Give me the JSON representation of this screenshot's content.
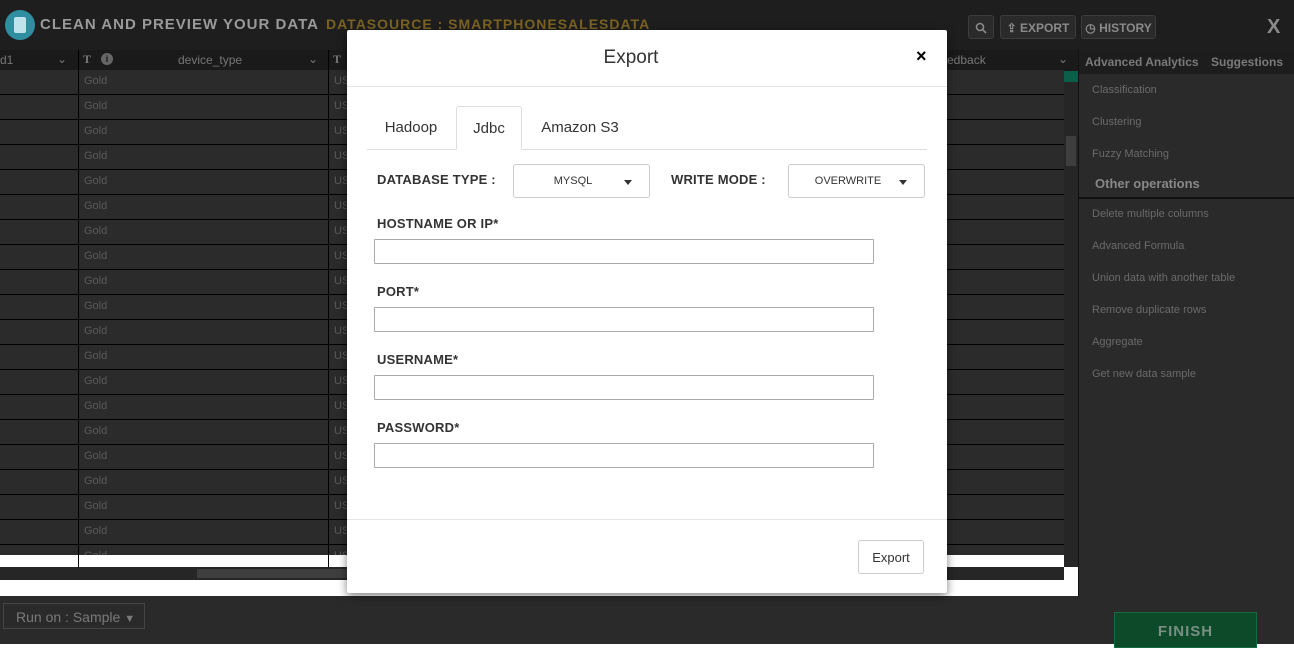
{
  "app": {
    "title": "CLEAN AND PREVIEW YOUR DATA",
    "datasource": "DATASOURCE : SMARTPHONESALESDATA",
    "export_label": "EXPORT",
    "history_label": "HISTORY",
    "close_label": "X"
  },
  "grid": {
    "col1_header": "d1",
    "col2_type": "T",
    "col2_header": "device_type",
    "col3_type": "T",
    "col4_header": "edback",
    "cell_value": "Gold",
    "cell_value_2": "US"
  },
  "right_panel": {
    "tabs": [
      "Advanced Analytics",
      "Suggestions"
    ],
    "items_top": [
      "Classification",
      "Clustering",
      "Fuzzy Matching"
    ],
    "section_title": "Other operations",
    "items_bottom": [
      "Delete multiple columns",
      "Advanced Formula",
      "Union data with another table",
      "Remove duplicate rows",
      "Aggregate",
      "Get new data sample"
    ]
  },
  "bottom": {
    "run_on_label": "Run on : Sample",
    "finish_label": "FINISH"
  },
  "modal": {
    "title": "Export",
    "close_glyph": "×",
    "tabs": [
      "Hadoop",
      "Jdbc",
      "Amazon S3"
    ],
    "active_tab": "Jdbc",
    "database_type_label": "DATABASE TYPE :",
    "database_type_value": "MYSQL",
    "write_mode_label": "WRITE MODE :",
    "write_mode_value": "OVERWRITE",
    "hostname_label": "HOSTNAME OR IP*",
    "hostname_value": "",
    "port_label": "PORT*",
    "port_value": "",
    "username_label": "USERNAME*",
    "username_value": "",
    "password_label": "PASSWORD*",
    "password_value": "",
    "export_button": "Export"
  },
  "colors": {
    "header_bg": "#1e1e1e",
    "accent_teal": "#2f8fa0",
    "datasource_gold": "#7a6222",
    "finish_green": "#0c4a2a"
  }
}
